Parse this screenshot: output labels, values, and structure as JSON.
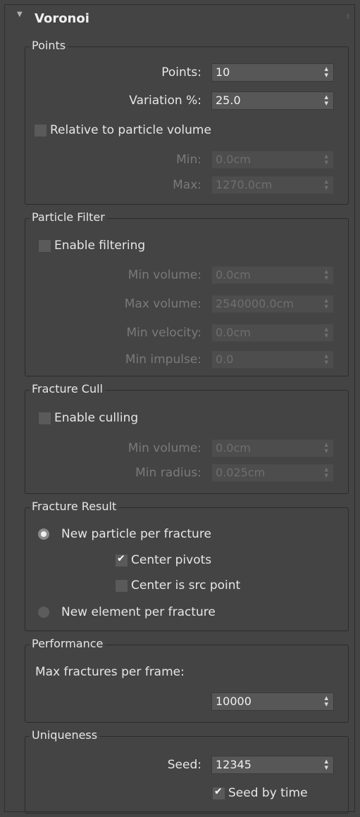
{
  "rollout": {
    "title": "Voronoi"
  },
  "points": {
    "title": "Points",
    "points_label": "Points:",
    "points_value": "10",
    "variation_label": "Variation %:",
    "variation_value": "25.0",
    "relative_label": "Relative to particle volume",
    "relative_checked": false,
    "min_label": "Min:",
    "min_value": "0.0cm",
    "max_label": "Max:",
    "max_value": "1270.0cm"
  },
  "particle_filter": {
    "title": "Particle Filter",
    "enable_label": "Enable filtering",
    "enable_checked": false,
    "min_volume_label": "Min volume:",
    "min_volume_value": "0.0cm",
    "max_volume_label": "Max volume:",
    "max_volume_value": "2540000.0cm",
    "min_velocity_label": "Min velocity:",
    "min_velocity_value": "0.0cm",
    "min_impulse_label": "Min impulse:",
    "min_impulse_value": "0.0"
  },
  "fracture_cull": {
    "title": "Fracture Cull",
    "enable_label": "Enable culling",
    "enable_checked": false,
    "min_volume_label": "Min volume:",
    "min_volume_value": "0.0cm",
    "min_radius_label": "Min radius:",
    "min_radius_value": "0.025cm"
  },
  "fracture_result": {
    "title": "Fracture Result",
    "new_particle_label": "New particle per fracture",
    "new_particle_selected": true,
    "center_pivots_label": "Center pivots",
    "center_pivots_checked": true,
    "center_src_label": "Center is src point",
    "center_src_checked": false,
    "new_element_label": "New element per fracture",
    "new_element_selected": false
  },
  "performance": {
    "title": "Performance",
    "max_fractures_label": "Max fractures per frame:",
    "max_fractures_value": "10000"
  },
  "uniqueness": {
    "title": "Uniqueness",
    "seed_label": "Seed:",
    "seed_value": "12345",
    "seed_by_time_label": "Seed by time",
    "seed_by_time_checked": true
  },
  "icons": {
    "collapse": "triangle-down",
    "spinner": "up-down-arrows",
    "check": "checkmark",
    "grip": "dotted-grip"
  }
}
